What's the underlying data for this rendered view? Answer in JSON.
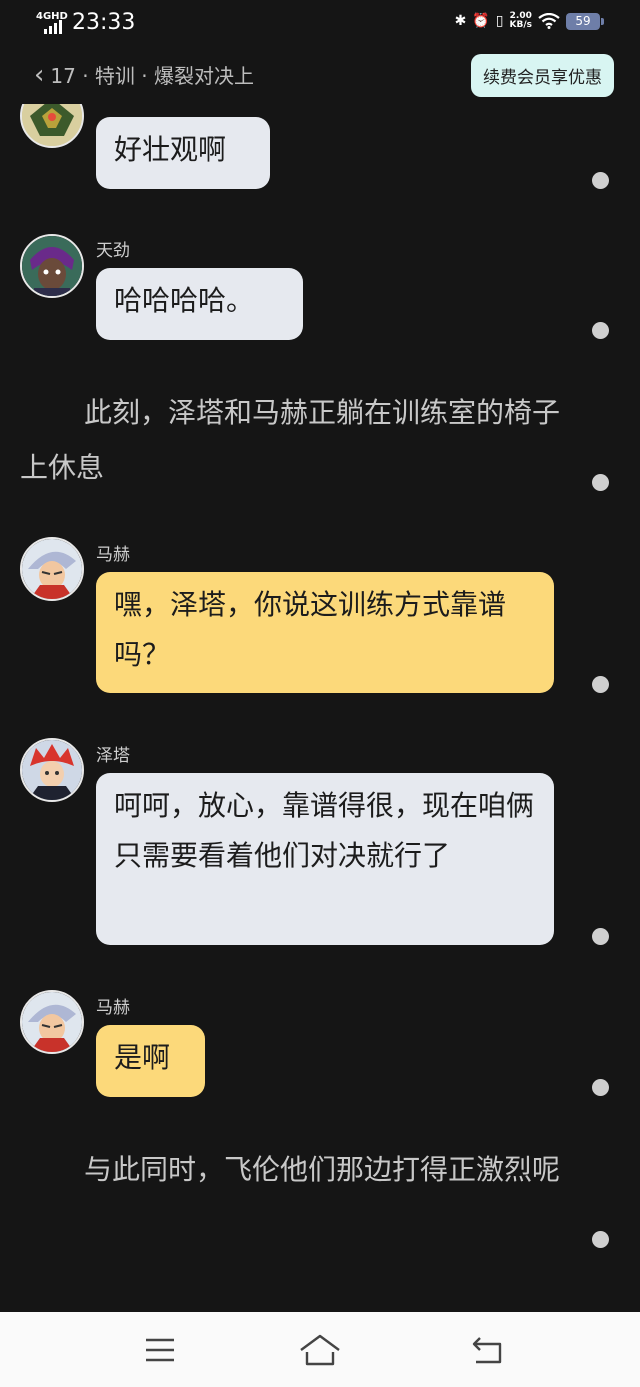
{
  "status_bar": {
    "network": "4GHD",
    "time": "23:33",
    "speed": "2.00",
    "speed_unit": "KB/s",
    "battery": "59"
  },
  "header": {
    "back_title": "17 · 特训 · 爆裂对决上",
    "vip_button": "续费会员享优惠"
  },
  "messages": {
    "m1": {
      "text": "好壮观啊"
    },
    "m2": {
      "name": "天劲",
      "text": "哈哈哈哈。"
    },
    "n1": {
      "text": "此刻，泽塔和马赫正躺在训练室的椅子上休息"
    },
    "m3": {
      "name": "马赫",
      "text": "嘿，泽塔，你说这训练方式靠谱吗？"
    },
    "m4": {
      "name": "泽塔",
      "text": "呵呵，放心，靠谱得很，现在咱俩只需要看着他们对决就行了"
    },
    "m5": {
      "name": "马赫",
      "text": "是啊"
    },
    "n2": {
      "text": "与此同时，飞伦他们那边打得正激烈呢"
    }
  },
  "colors": {
    "background": "#151515",
    "bubble_gray": "#e6e9ef",
    "bubble_yellow": "#fcd97a",
    "vip_bg": "#d8f5f2"
  }
}
